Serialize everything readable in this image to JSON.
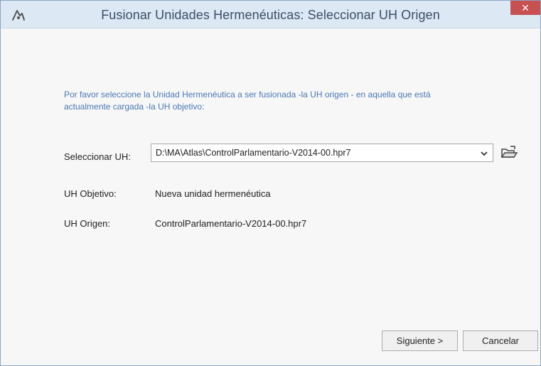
{
  "window": {
    "title": "Fusionar Unidades Hermenéuticas: Seleccionar UH Origen",
    "close_glyph": "✕",
    "app_icon": "atlas-ti-icon"
  },
  "instructions": "Por favor seleccione la Unidad Hermenéutica a ser fusionada -la UH origen - en aquella que está actualmente cargada -la UH objetivo:",
  "select_uh": {
    "label": "Seleccionar UH:",
    "value": "D:\\MA\\Atlas\\ControlParlamentario-V2014-00.hpr7",
    "dropdown_icon": "chevron-down-icon",
    "browse_icon": "folder-open-icon"
  },
  "target_uh": {
    "label": "UH Objetivo:",
    "value": "Nueva unidad hermenéutica"
  },
  "source_uh": {
    "label": "UH Origen:",
    "value": "ControlParlamentario-V2014-00.hpr7"
  },
  "buttons": {
    "next": "Siguiente >",
    "cancel": "Cancelar"
  },
  "colors": {
    "instruction_text": "#4a78b4",
    "title_text": "#3c4f66",
    "close_bg": "#c75050",
    "titlebar_bg": "#dde8f5"
  }
}
